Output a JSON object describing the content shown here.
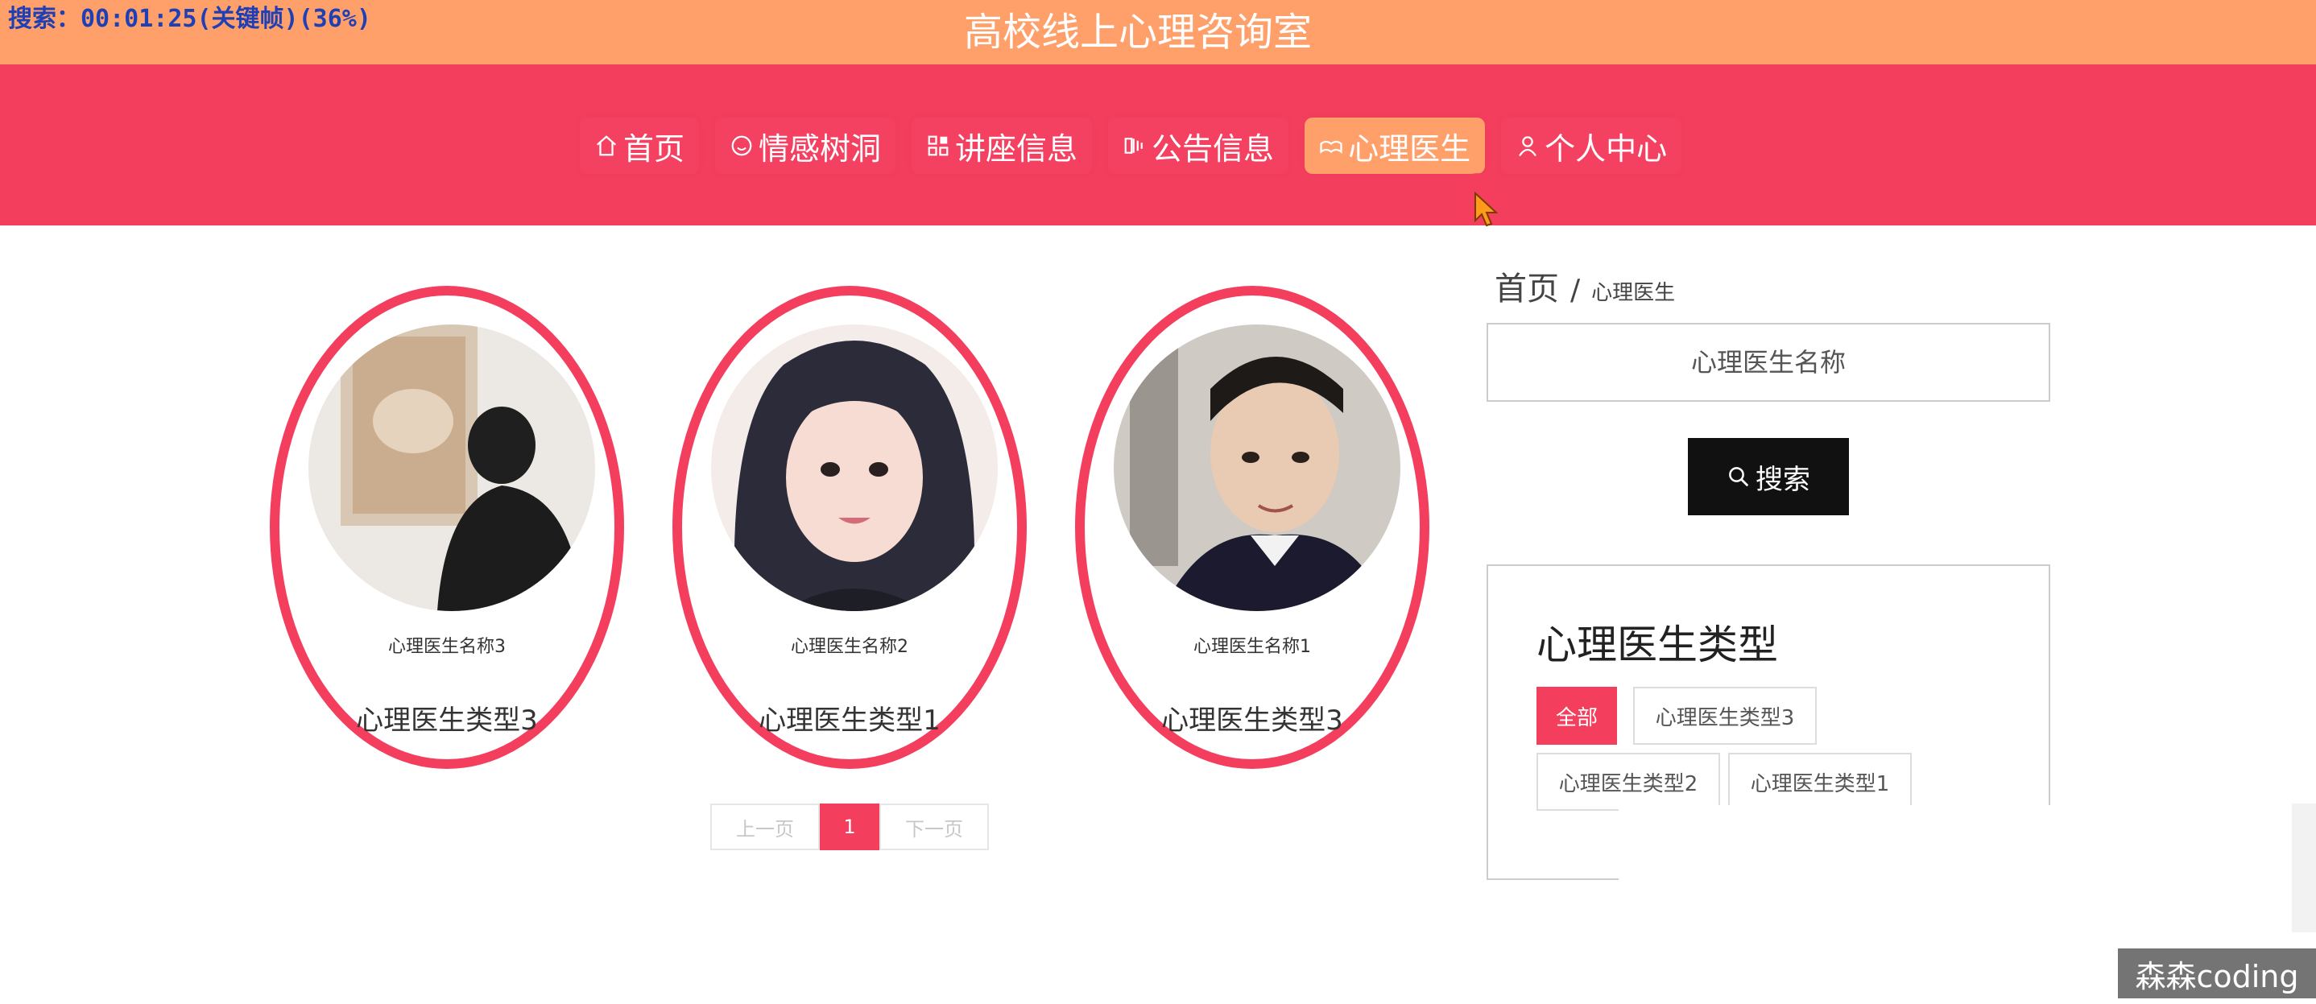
{
  "overlay": {
    "search_timer": "搜索：00:01:25(关键帧)(36%)"
  },
  "header": {
    "title": "高校线上心理咨询室"
  },
  "nav": {
    "items": [
      {
        "label": "首页",
        "icon": "home-icon",
        "active": false
      },
      {
        "label": "情感树洞",
        "icon": "smile-icon",
        "active": false
      },
      {
        "label": "讲座信息",
        "icon": "grid-icon",
        "active": false
      },
      {
        "label": "公告信息",
        "icon": "announcement-icon",
        "active": false
      },
      {
        "label": "心理医生",
        "icon": "doctor-icon",
        "active": true
      },
      {
        "label": "个人中心",
        "icon": "user-icon",
        "active": false
      }
    ]
  },
  "doctors": [
    {
      "name": "心理医生名称3",
      "type": "心理医生类型3"
    },
    {
      "name": "心理医生名称2",
      "type": "心理医生类型1"
    },
    {
      "name": "心理医生名称1",
      "type": "心理医生类型3"
    }
  ],
  "pagination": {
    "prev": "上一页",
    "current": "1",
    "next": "下一页"
  },
  "sidebar": {
    "breadcrumb": {
      "home": "首页",
      "separator": "/",
      "current": "心理医生"
    },
    "search": {
      "placeholder": "心理医生名称",
      "button": "搜索"
    },
    "types": {
      "title": "心理医生类型",
      "tags": [
        "全部",
        "心理医生类型3",
        "心理医生类型2",
        "心理医生类型1"
      ],
      "selected": "全部"
    }
  },
  "watermark": "森森coding",
  "colors": {
    "accent": "#f43e5e",
    "orange": "#ffa06b",
    "dark_button": "#111111"
  }
}
